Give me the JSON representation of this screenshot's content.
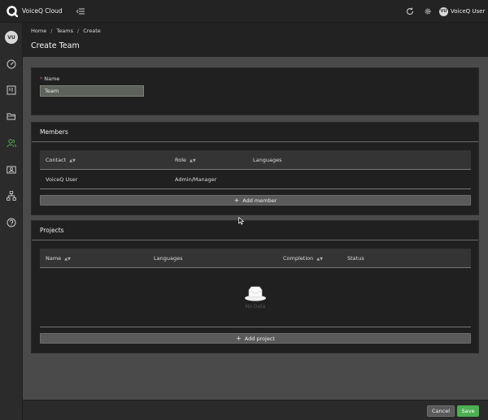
{
  "app": {
    "title": "VoiceQ Cloud"
  },
  "topbar": {
    "icons": [
      "menu-toggle-icon",
      "refresh-icon",
      "gear-icon"
    ],
    "user": {
      "initials": "VU",
      "name": "VoiceQ User"
    }
  },
  "sidebar": {
    "avatar_initials": "VU",
    "items": [
      "dashboard-icon",
      "board-icon",
      "folder-icon",
      "teams-icon",
      "contact-card-icon",
      "hierarchy-icon",
      "help-icon"
    ],
    "active": "teams-icon"
  },
  "breadcrumb": [
    "Home",
    "Teams",
    "Create"
  ],
  "page_title": "Create Team",
  "name_section": {
    "label": "Name",
    "value": "Team"
  },
  "members": {
    "title": "Members",
    "columns": [
      "Contact",
      "Role",
      "Languages"
    ],
    "rows": [
      {
        "contact": "VoiceQ User",
        "role": "Admin/Manager",
        "languages": ""
      }
    ],
    "add_label": "Add member"
  },
  "projects": {
    "title": "Projects",
    "columns": [
      "Name",
      "Languages",
      "Completion",
      "Status"
    ],
    "empty_text": "No Data",
    "add_label": "Add project"
  },
  "footer": {
    "cancel_label": "Cancel",
    "save_label": "Save"
  },
  "colors": {
    "accent": "#4caf50",
    "background": "#4a4a4a",
    "card": "#202020",
    "topbar": "#232323"
  }
}
